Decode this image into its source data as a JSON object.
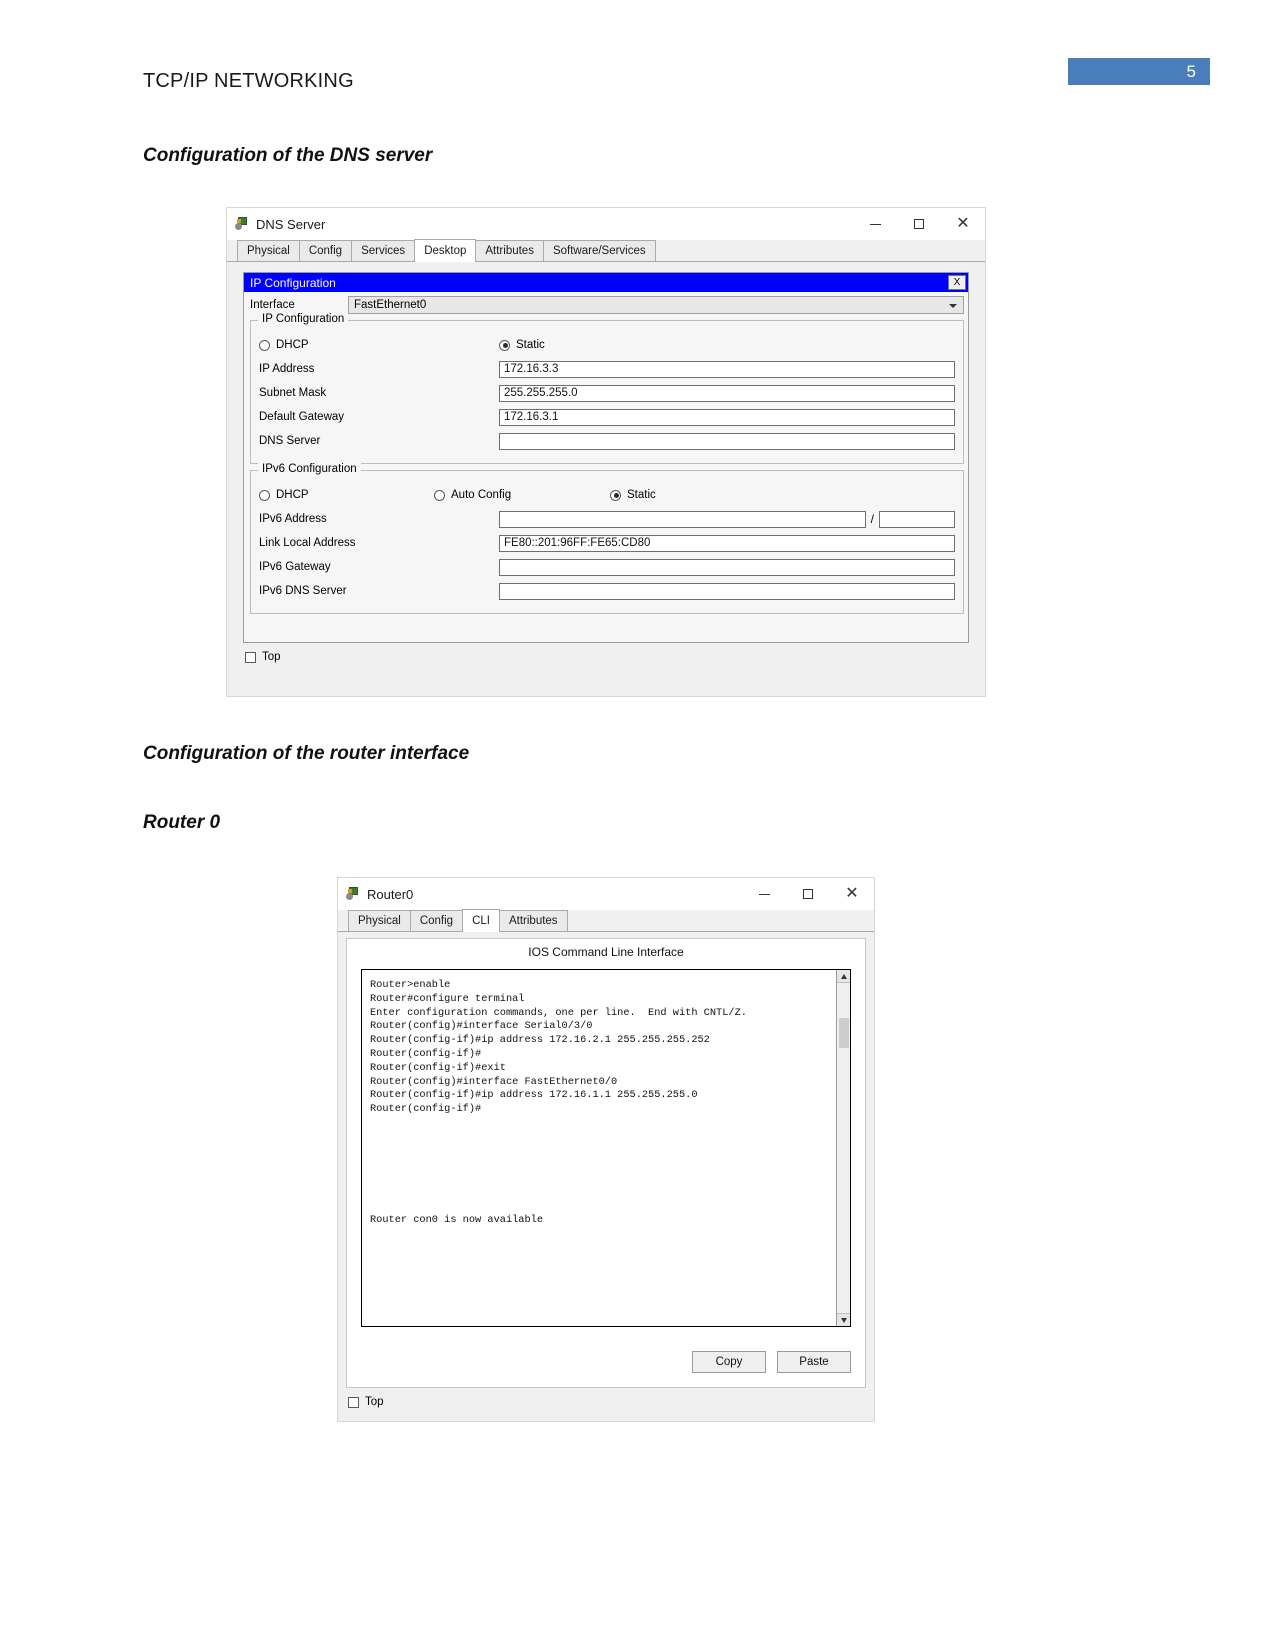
{
  "document": {
    "running_head": "TCP/IP NETWORKING",
    "page_number": "5",
    "page_badge_color": "#4a7ebb",
    "headings": {
      "dns": "Configuration of the DNS server",
      "router_interface": "Configuration of the router interface",
      "router0": "Router 0"
    }
  },
  "dns_window": {
    "title": "DNS Server",
    "title_icon": "packet-tracer-device-icon",
    "window_buttons": {
      "minimize": "minimize-icon",
      "maximize": "maximize-icon",
      "close": "close-icon"
    },
    "tabs": [
      {
        "label": "Physical",
        "active": false
      },
      {
        "label": "Config",
        "active": false
      },
      {
        "label": "Services",
        "active": false
      },
      {
        "label": "Desktop",
        "active": true
      },
      {
        "label": "Attributes",
        "active": false
      },
      {
        "label": "Software/Services",
        "active": false
      }
    ],
    "dialog": {
      "title": "IP Configuration",
      "close_label": "X",
      "title_bar_color": "#0000ff",
      "interface": {
        "label": "Interface",
        "value": "FastEthernet0"
      },
      "ipv4": {
        "legend": "IP Configuration",
        "dhcp_label": "DHCP",
        "dhcp_selected": false,
        "static_label": "Static",
        "static_selected": true,
        "fields": [
          {
            "label": "IP Address",
            "value": "172.16.3.3"
          },
          {
            "label": "Subnet Mask",
            "value": "255.255.255.0"
          },
          {
            "label": "Default Gateway",
            "value": "172.16.3.1"
          },
          {
            "label": "DNS Server",
            "value": ""
          }
        ]
      },
      "ipv6": {
        "legend": "IPv6 Configuration",
        "dhcp_label": "DHCP",
        "dhcp_selected": false,
        "auto_config_label": "Auto Config",
        "auto_config_selected": false,
        "static_label": "Static",
        "static_selected": true,
        "address_label": "IPv6 Address",
        "address_value": "",
        "prefix_value": "",
        "prefix_separator": "/",
        "fields": [
          {
            "label": "Link Local Address",
            "value": "FE80::201:96FF:FE65:CD80"
          },
          {
            "label": "IPv6 Gateway",
            "value": ""
          },
          {
            "label": "IPv6 DNS Server",
            "value": ""
          }
        ]
      }
    },
    "top_checkbox": {
      "label": "Top",
      "checked": false
    }
  },
  "router_window": {
    "title": "Router0",
    "title_icon": "packet-tracer-device-icon",
    "window_buttons": {
      "minimize": "minimize-icon",
      "maximize": "maximize-icon",
      "close": "close-icon"
    },
    "tabs": [
      {
        "label": "Physical",
        "active": false
      },
      {
        "label": "Config",
        "active": false
      },
      {
        "label": "CLI",
        "active": true
      },
      {
        "label": "Attributes",
        "active": false
      }
    ],
    "cli": {
      "heading": "IOS Command Line Interface",
      "text": "Router>enable\nRouter#configure terminal\nEnter configuration commands, one per line.  End with CNTL/Z.\nRouter(config)#interface Serial0/3/0\nRouter(config-if)#ip address 172.16.2.1 255.255.255.252\nRouter(config-if)#\nRouter(config-if)#exit\nRouter(config)#interface FastEthernet0/0\nRouter(config-if)#ip address 172.16.1.1 255.255.255.0\nRouter(config-if)#\n\n\n\n\n\n\n\nRouter con0 is now available",
      "scrollbar": "vertical-scrollbar",
      "copy_button": "Copy",
      "paste_button": "Paste"
    },
    "top_checkbox": {
      "label": "Top",
      "checked": false
    }
  }
}
